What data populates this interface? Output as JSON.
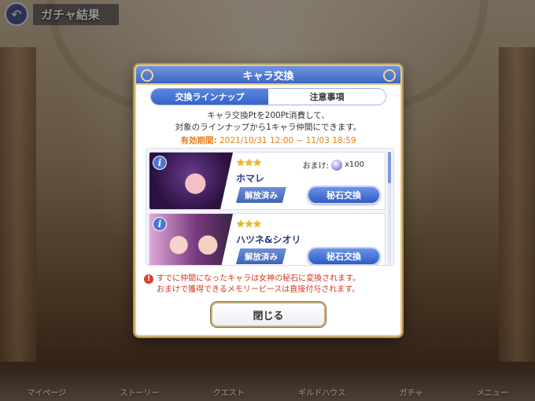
{
  "header": {
    "back_icon": "back-arrow-icon",
    "title": "ガチャ結果"
  },
  "modal": {
    "title": "キャラ交換",
    "tabs": [
      {
        "label": "交換ラインナップ",
        "active": true
      },
      {
        "label": "注意事項",
        "active": false
      }
    ],
    "description_line1": "キャラ交換Ptを200Pt消費して、",
    "description_line2": "対象のラインナップから1キャラ仲間にできます。",
    "period_label": "有効期間:",
    "period_value": "2021/10/31 12:00 ~ 11/03 18:59",
    "items": [
      {
        "stars": "★★★",
        "name": "ホマレ",
        "omake_label": "おまけ:",
        "omake_value": "x100",
        "status": "解放済み",
        "button": "秘石交換"
      },
      {
        "stars": "★★★",
        "name": "ハツネ&シオリ",
        "status": "解放済み",
        "button": "秘石交換"
      }
    ],
    "note_line1": "すでに仲間になったキャラは女神の秘石に変換されます。",
    "note_line2": "おまけで獲得できるメモリーピースは直接付与されます。",
    "close_label": "閉じる"
  },
  "bottom_nav": [
    "マイページ",
    "ストーリー",
    "クエスト",
    "ギルドハウス",
    "ガチャ",
    "メニュー"
  ],
  "colors": {
    "accent_blue": "#3d66c4",
    "period_orange": "#e87e18",
    "warning_red": "#d8341f",
    "star_gold": "#f4b80a"
  }
}
